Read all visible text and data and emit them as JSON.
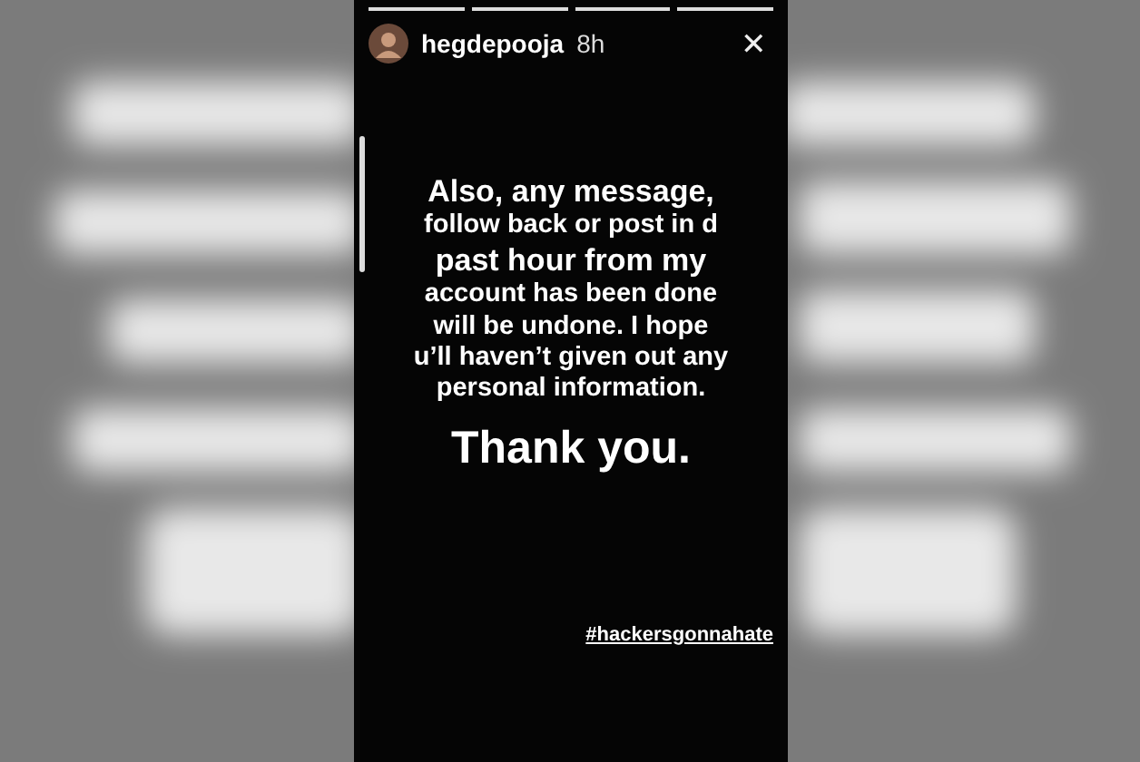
{
  "story": {
    "progress": [
      {
        "level": 1
      },
      {
        "level": 1
      },
      {
        "level": 1
      },
      {
        "level": 1
      }
    ],
    "username": "hegdepooja",
    "time": "8h",
    "close": "✕",
    "lines": [
      {
        "text": "Also, any message,",
        "kind": "large"
      },
      {
        "text": "follow back or post in d",
        "kind": "small"
      },
      {
        "text": "past hour from my",
        "kind": "large"
      },
      {
        "text": "account has been done",
        "kind": "small"
      },
      {
        "text": "will be undone. I hope",
        "kind": "small"
      },
      {
        "text": "u’ll haven’t given out any",
        "kind": "small"
      },
      {
        "text": "personal information.",
        "kind": "small"
      },
      {
        "text": "Thank you.",
        "kind": "heading"
      }
    ],
    "hashtag": "#hackersgonnahate"
  }
}
